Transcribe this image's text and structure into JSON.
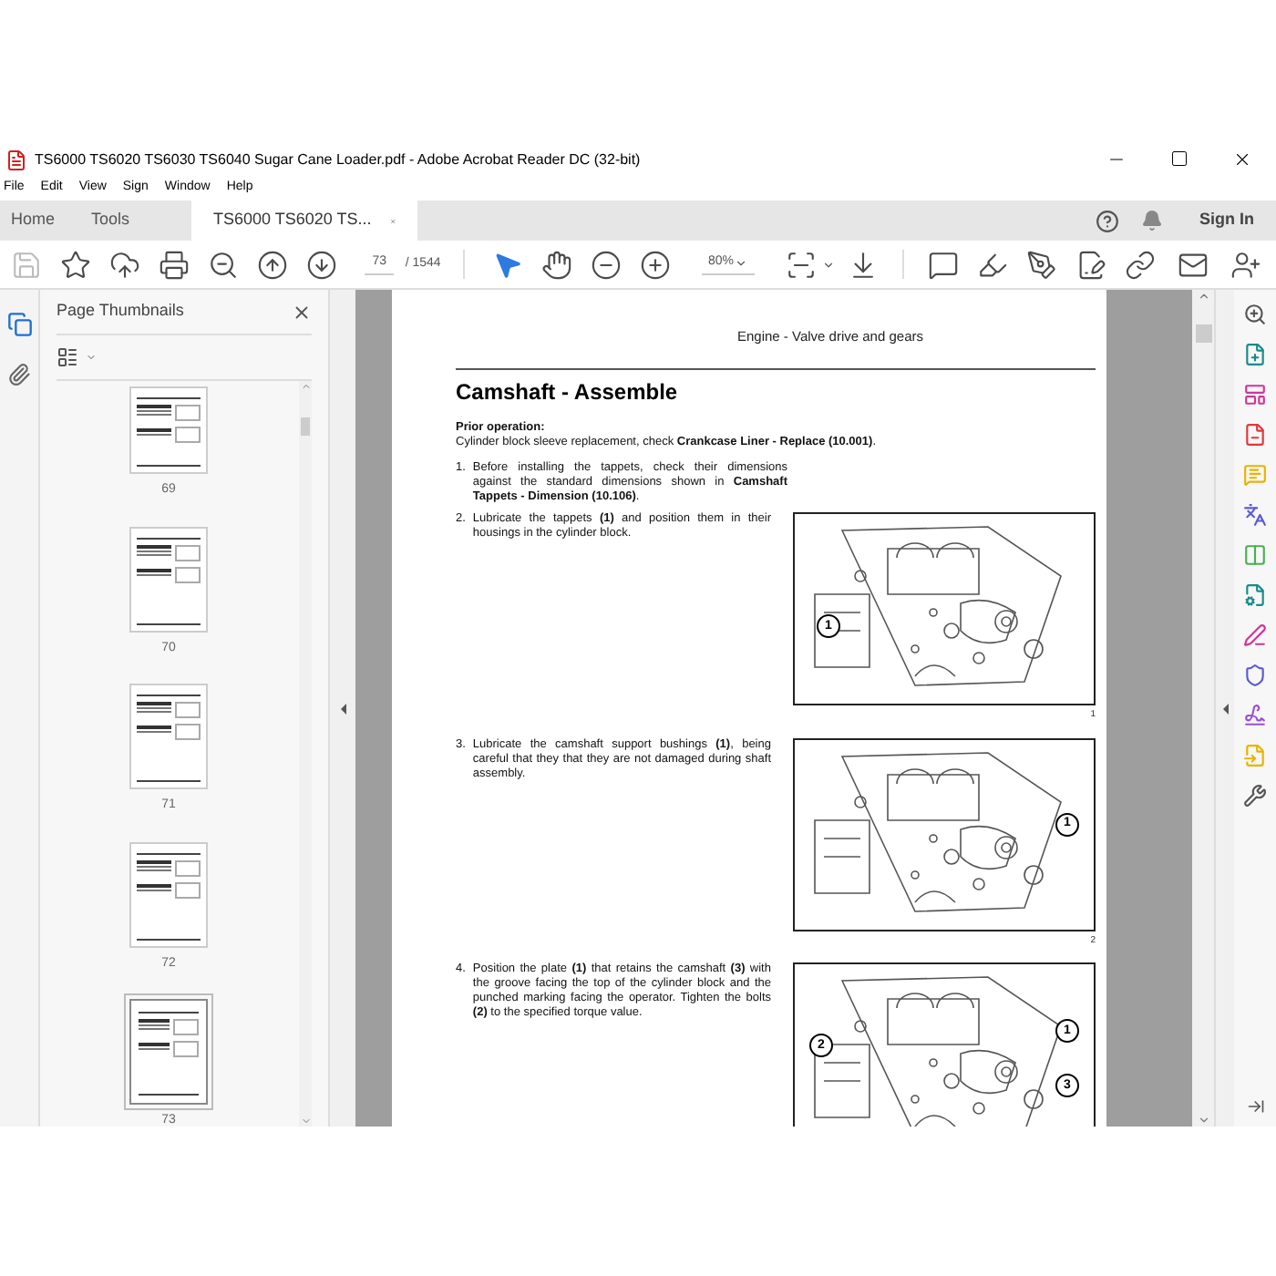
{
  "window": {
    "title": "TS6000 TS6020 TS6030 TS6040 Sugar Cane Loader.pdf - Adobe Acrobat Reader DC (32-bit)"
  },
  "menu": [
    "File",
    "Edit",
    "View",
    "Sign",
    "Window",
    "Help"
  ],
  "tabs": [
    {
      "label": "Home",
      "selected": false
    },
    {
      "label": "Tools",
      "selected": false
    },
    {
      "label": "TS6000 TS6020 TS...",
      "selected": true
    }
  ],
  "sign_in": "Sign In",
  "toolbar": {
    "page": "73",
    "total": "/ 1544",
    "zoom": "80%"
  },
  "thumbnails": {
    "title": "Page Thumbnails",
    "pages": [
      {
        "label": "69",
        "selected": false
      },
      {
        "label": "70",
        "selected": false
      },
      {
        "label": "71",
        "selected": false
      },
      {
        "label": "72",
        "selected": false
      },
      {
        "label": "73",
        "selected": true
      }
    ]
  },
  "document": {
    "header": "Engine - Valve drive and gears",
    "title": "Camshaft - Assemble",
    "prior_label": "Prior operation:",
    "prior_text": "Cylinder block sleeve replacement, check **Crankcase Liner - Replace (10.001)**.",
    "sections": [
      {
        "number": "1.",
        "text": "Before installing the tappets, check their dimensions against the standard dimensions shown in **Camshaft Tappets - Dimension (10.106)**."
      },
      {
        "number": "2.",
        "text": "Lubricate the tappets **(1)** and position them in their housings in the cylinder block.",
        "figure": {
          "number": "1",
          "callouts": [
            "1"
          ]
        }
      },
      {
        "number": "3.",
        "text": "Lubricate the camshaft support bushings **(1)**, being careful that they that they are not damaged during shaft assembly.",
        "figure": {
          "number": "2",
          "callouts": [
            "1"
          ]
        }
      },
      {
        "number": "4.",
        "text": "Position the plate **(1)** that retains the camshaft **(3)** with the groove facing the top of the cylinder block and the punched marking facing the operator. Tighten the bolts **(2)** to the specified torque value.",
        "figure": {
          "callouts": [
            "2",
            "1",
            "3"
          ]
        }
      }
    ]
  }
}
